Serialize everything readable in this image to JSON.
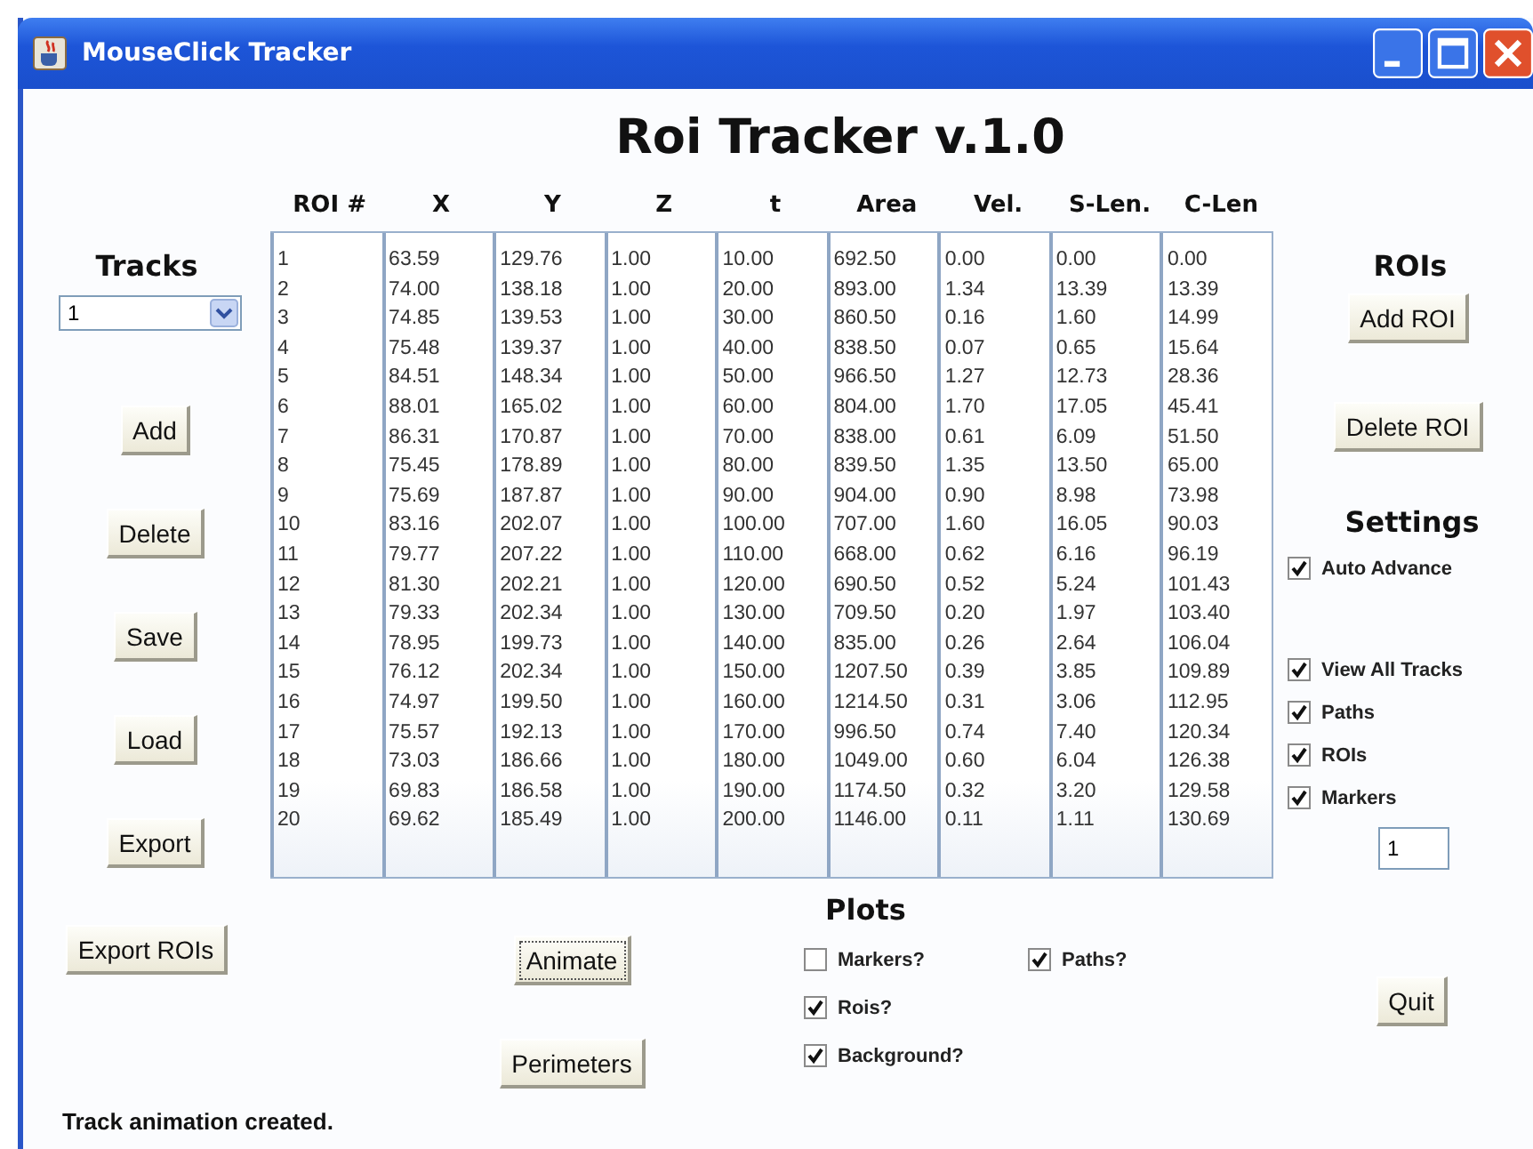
{
  "window": {
    "title": "MouseClick Tracker"
  },
  "heading": "Roi Tracker v.1.0",
  "tracks": {
    "title": "Tracks",
    "selector": "1",
    "buttons": [
      "Add",
      "Delete",
      "Save",
      "Load",
      "Export",
      "Export ROIs"
    ]
  },
  "table": {
    "columns": [
      "ROI #",
      "X",
      "Y",
      "Z",
      "t",
      "Area",
      "Vel.",
      "S-Len.",
      "C-Len"
    ],
    "rows": [
      [
        "1",
        "63.59",
        "129.76",
        "1.00",
        "10.00",
        "692.50",
        "0.00",
        "0.00",
        "0.00"
      ],
      [
        "2",
        "74.00",
        "138.18",
        "1.00",
        "20.00",
        "893.00",
        "1.34",
        "13.39",
        "13.39"
      ],
      [
        "3",
        "74.85",
        "139.53",
        "1.00",
        "30.00",
        "860.50",
        "0.16",
        "1.60",
        "14.99"
      ],
      [
        "4",
        "75.48",
        "139.37",
        "1.00",
        "40.00",
        "838.50",
        "0.07",
        "0.65",
        "15.64"
      ],
      [
        "5",
        "84.51",
        "148.34",
        "1.00",
        "50.00",
        "966.50",
        "1.27",
        "12.73",
        "28.36"
      ],
      [
        "6",
        "88.01",
        "165.02",
        "1.00",
        "60.00",
        "804.00",
        "1.70",
        "17.05",
        "45.41"
      ],
      [
        "7",
        "86.31",
        "170.87",
        "1.00",
        "70.00",
        "838.00",
        "0.61",
        "6.09",
        "51.50"
      ],
      [
        "8",
        "75.45",
        "178.89",
        "1.00",
        "80.00",
        "839.50",
        "1.35",
        "13.50",
        "65.00"
      ],
      [
        "9",
        "75.69",
        "187.87",
        "1.00",
        "90.00",
        "904.00",
        "0.90",
        "8.98",
        "73.98"
      ],
      [
        "10",
        "83.16",
        "202.07",
        "1.00",
        "100.00",
        "707.00",
        "1.60",
        "16.05",
        "90.03"
      ],
      [
        "11",
        "79.77",
        "207.22",
        "1.00",
        "110.00",
        "668.00",
        "0.62",
        "6.16",
        "96.19"
      ],
      [
        "12",
        "81.30",
        "202.21",
        "1.00",
        "120.00",
        "690.50",
        "0.52",
        "5.24",
        "101.43"
      ],
      [
        "13",
        "79.33",
        "202.34",
        "1.00",
        "130.00",
        "709.50",
        "0.20",
        "1.97",
        "103.40"
      ],
      [
        "14",
        "78.95",
        "199.73",
        "1.00",
        "140.00",
        "835.00",
        "0.26",
        "2.64",
        "106.04"
      ],
      [
        "15",
        "76.12",
        "202.34",
        "1.00",
        "150.00",
        "1207.50",
        "0.39",
        "3.85",
        "109.89"
      ],
      [
        "16",
        "74.97",
        "199.50",
        "1.00",
        "160.00",
        "1214.50",
        "0.31",
        "3.06",
        "112.95"
      ],
      [
        "17",
        "75.57",
        "192.13",
        "1.00",
        "170.00",
        "996.50",
        "0.74",
        "7.40",
        "120.34"
      ],
      [
        "18",
        "73.03",
        "186.66",
        "1.00",
        "180.00",
        "1049.00",
        "0.60",
        "6.04",
        "126.38"
      ],
      [
        "19",
        "69.83",
        "186.58",
        "1.00",
        "190.00",
        "1174.50",
        "0.32",
        "3.20",
        "129.58"
      ],
      [
        "20",
        "69.62",
        "185.49",
        "1.00",
        "200.00",
        "1146.00",
        "0.11",
        "1.11",
        "130.69"
      ]
    ]
  },
  "rois": {
    "title": "ROIs",
    "buttons": [
      "Add ROI",
      "Delete ROI"
    ]
  },
  "settings": {
    "title": "Settings",
    "options": [
      {
        "label": "Auto Advance",
        "checked": true
      },
      {
        "label": "View All Tracks",
        "checked": true
      },
      {
        "label": "Paths",
        "checked": true
      },
      {
        "label": "ROIs",
        "checked": true
      },
      {
        "label": "Markers",
        "checked": true
      }
    ],
    "markers_value": "1"
  },
  "plots": {
    "title": "Plots",
    "buttons": [
      "Animate",
      "Perimeters"
    ],
    "options": [
      {
        "label": "Markers?",
        "checked": false
      },
      {
        "label": "Paths?",
        "checked": true
      },
      {
        "label": "Rois?",
        "checked": true
      },
      {
        "label": "Background?",
        "checked": true
      }
    ]
  },
  "quit": "Quit",
  "status_bar": "Track animation created."
}
